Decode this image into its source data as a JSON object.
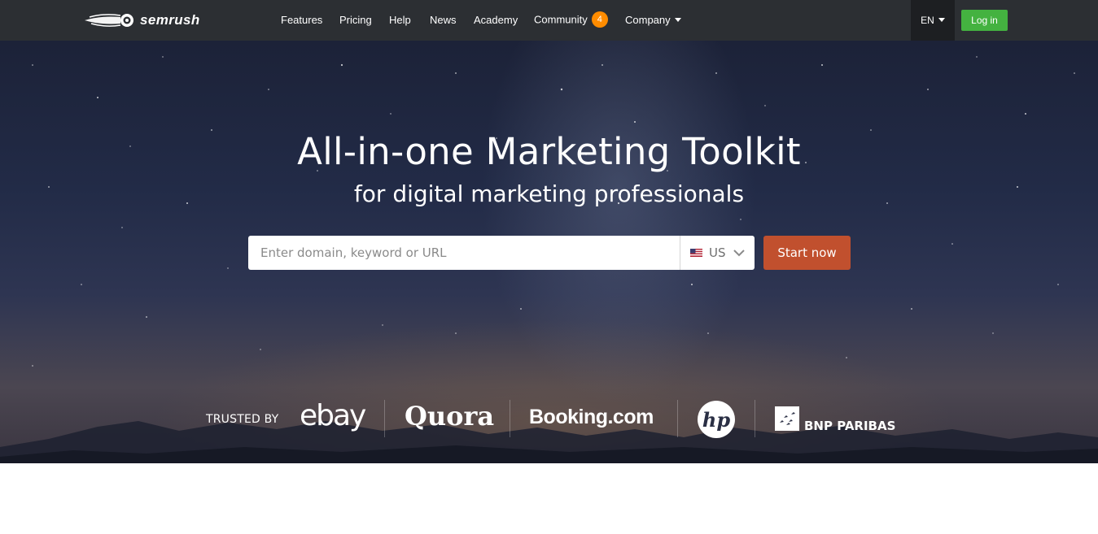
{
  "brand": {
    "name": "semrush",
    "logo_icon": "fireball-icon"
  },
  "nav": {
    "items": [
      {
        "label": "Features"
      },
      {
        "label": "Pricing"
      },
      {
        "label": "Help"
      },
      {
        "label": "News"
      },
      {
        "label": "Academy"
      },
      {
        "label": "Community",
        "badge": "4"
      },
      {
        "label": "Company",
        "dropdown": true
      }
    ],
    "language": "EN",
    "login_label": "Log in"
  },
  "hero": {
    "title": "All-in-one Marketing Toolkit",
    "subtitle": "for digital marketing professionals",
    "search_placeholder": "Enter domain, keyword or URL",
    "database": {
      "selected": "US",
      "flag_icon": "us-flag-icon"
    },
    "cta_label": "Start now"
  },
  "trusted": {
    "label": "TRUSTED BY",
    "brands": [
      "ebay",
      "Quora",
      "Booking.com",
      "hp",
      "BNP PARIBAS"
    ]
  },
  "colors": {
    "topbar": "#2c2f33",
    "login": "#44b240",
    "cta": "#c1502e",
    "badge": "#ff8c00"
  }
}
